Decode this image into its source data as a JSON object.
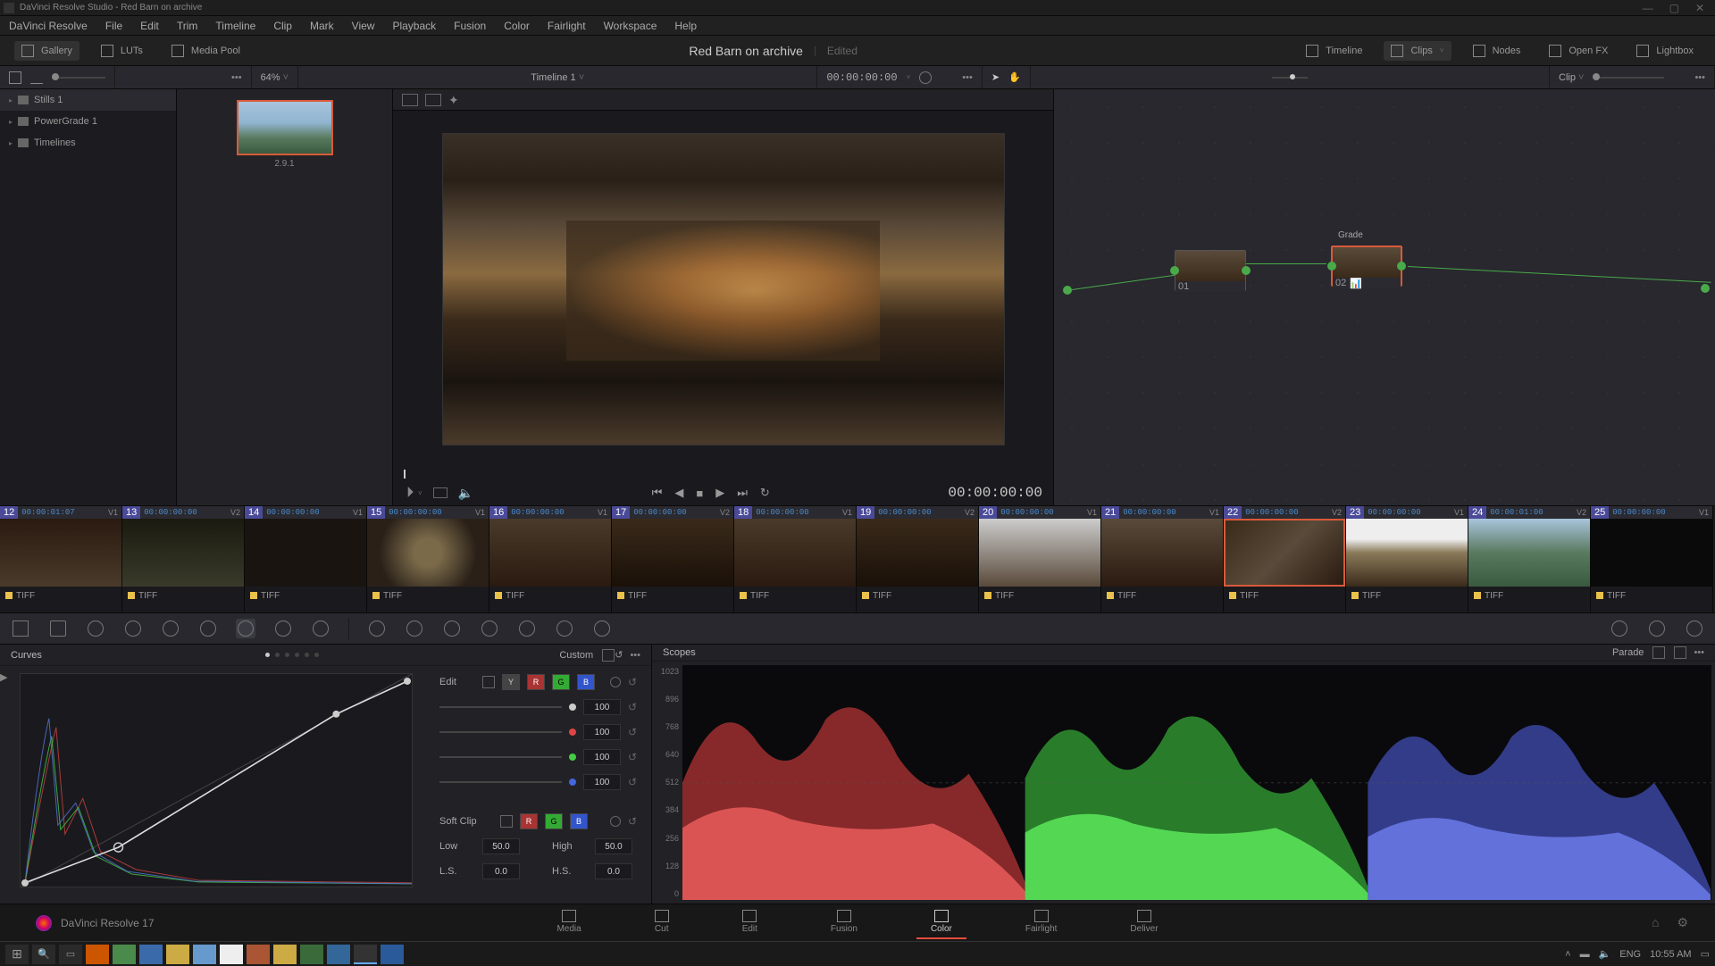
{
  "window": {
    "title": "DaVinci Resolve Studio - Red Barn on archive"
  },
  "menu": [
    "DaVinci Resolve",
    "File",
    "Edit",
    "Trim",
    "Timeline",
    "Clip",
    "Mark",
    "View",
    "Playback",
    "Fusion",
    "Color",
    "Fairlight",
    "Workspace",
    "Help"
  ],
  "topbar": {
    "gallery": "Gallery",
    "luts": "LUTs",
    "mpool": "Media Pool",
    "project": "Red Barn on archive",
    "status": "Edited",
    "timeline": "Timeline",
    "clips": "Clips",
    "nodes": "Nodes",
    "openfx": "Open FX",
    "lightbox": "Lightbox"
  },
  "toolbar": {
    "zoom": "64%",
    "timeline": "Timeline 1",
    "tc": "00:00:00:00",
    "clip": "Clip"
  },
  "gallery": {
    "tabs": [
      "Stills 1",
      "PowerGrade 1",
      "Timelines"
    ],
    "thumb_label": "2.9.1"
  },
  "viewer": {
    "tc": "00:00:00:00"
  },
  "nodes": {
    "grade_label": "Grade",
    "n1": "01",
    "n2": "02"
  },
  "clips": [
    {
      "n": "12",
      "tc": "00:00:01:07",
      "trk": "V1",
      "fmt": "TIFF"
    },
    {
      "n": "13",
      "tc": "00:00:00:00",
      "trk": "V2",
      "fmt": "TIFF"
    },
    {
      "n": "14",
      "tc": "00:00:00:00",
      "trk": "V1",
      "fmt": "TIFF"
    },
    {
      "n": "15",
      "tc": "00:00:00:00",
      "trk": "V1",
      "fmt": "TIFF"
    },
    {
      "n": "16",
      "tc": "00:00:00:00",
      "trk": "V1",
      "fmt": "TIFF"
    },
    {
      "n": "17",
      "tc": "00:00:00:00",
      "trk": "V2",
      "fmt": "TIFF"
    },
    {
      "n": "18",
      "tc": "00:00:00:00",
      "trk": "V1",
      "fmt": "TIFF"
    },
    {
      "n": "19",
      "tc": "00:00:00:00",
      "trk": "V2",
      "fmt": "TIFF"
    },
    {
      "n": "20",
      "tc": "00:00:00:00",
      "trk": "V1",
      "fmt": "TIFF"
    },
    {
      "n": "21",
      "tc": "00:00:00:00",
      "trk": "V1",
      "fmt": "TIFF"
    },
    {
      "n": "22",
      "tc": "00:00:00:00",
      "trk": "V2",
      "fmt": "TIFF"
    },
    {
      "n": "23",
      "tc": "00:00:00:00",
      "trk": "V1",
      "fmt": "TIFF"
    },
    {
      "n": "24",
      "tc": "00:00:01:00",
      "trk": "V2",
      "fmt": "TIFF"
    },
    {
      "n": "25",
      "tc": "00:00:00:00",
      "trk": "V1",
      "fmt": "TIFF"
    }
  ],
  "curves": {
    "title": "Curves",
    "mode": "Custom",
    "edit": "Edit",
    "ch": {
      "y": "Y",
      "r": "R",
      "g": "G",
      "b": "B"
    },
    "vals": {
      "w": "100",
      "r": "100",
      "g": "100",
      "b": "100"
    },
    "softclip": "Soft Clip",
    "low": "Low",
    "high": "High",
    "ls": "L.S.",
    "hs": "H.S.",
    "lowv": "50.0",
    "highv": "50.0",
    "lsv": "0.0",
    "hsv": "0.0"
  },
  "scopes": {
    "title": "Scopes",
    "mode": "Parade",
    "ticks": [
      "1023",
      "896",
      "768",
      "640",
      "512",
      "384",
      "256",
      "128",
      "0"
    ]
  },
  "pages": {
    "brand": "DaVinci Resolve 17",
    "media": "Media",
    "cut": "Cut",
    "edit": "Edit",
    "fusion": "Fusion",
    "color": "Color",
    "fairlight": "Fairlight",
    "deliver": "Deliver"
  },
  "taskbar": {
    "lang": "ENG",
    "time": "10:55 AM"
  }
}
